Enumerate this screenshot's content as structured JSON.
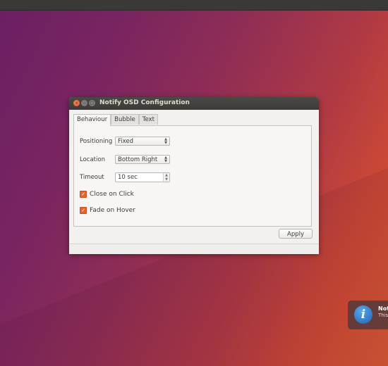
{
  "window": {
    "title": "Notify OSD Configuration",
    "buttons": {
      "close": "×",
      "minimize": "–",
      "maximize": "□"
    }
  },
  "tabs": [
    {
      "label": "Behaviour",
      "active": true
    },
    {
      "label": "Bubble",
      "active": false
    },
    {
      "label": "Text",
      "active": false
    }
  ],
  "behaviour": {
    "positioning": {
      "label": "Positioning",
      "value": "Fixed"
    },
    "location": {
      "label": "Location",
      "value": "Bottom Right"
    },
    "timeout": {
      "label": "Timeout",
      "value": "10 sec"
    },
    "close_on_click": {
      "label": "Close on Click",
      "checked": true
    },
    "fade_on_hover": {
      "label": "Fade on Hover",
      "checked": true
    }
  },
  "apply_label": "Apply",
  "notification": {
    "title": "Noti",
    "body": "This",
    "icon": "info-icon",
    "icon_glyph": "i"
  },
  "colors": {
    "accent": "#e6652e",
    "titlebar": "#3c3b37"
  }
}
